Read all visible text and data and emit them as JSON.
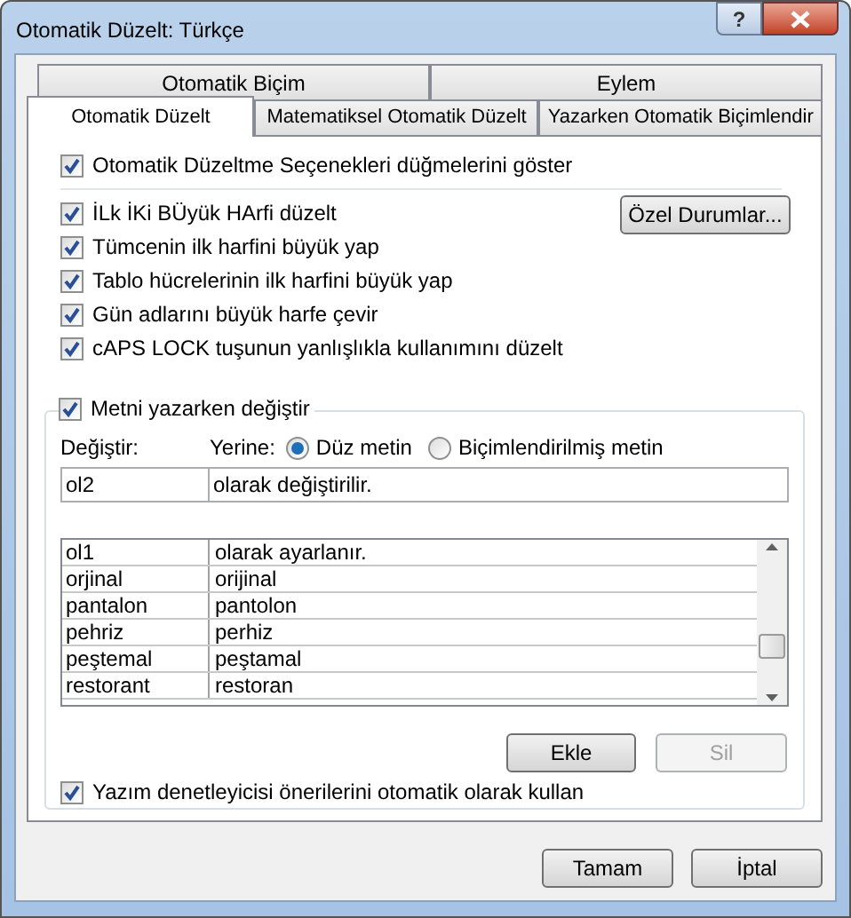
{
  "window": {
    "title": "Otomatik Düzelt: Türkçe",
    "help": "?"
  },
  "tab_rows": [
    [
      {
        "label": "Otomatik Biçim",
        "selected": false
      },
      {
        "label": "Eylem",
        "selected": false
      }
    ],
    [
      {
        "label": "Otomatik Düzelt",
        "selected": true
      },
      {
        "label": "Matematiksel Otomatik Düzelt",
        "selected": false
      },
      {
        "label": "Yazarken Otomatik Biçimlendir",
        "selected": false
      }
    ]
  ],
  "show_buttons_option": {
    "label": "Otomatik Düzeltme Seçenekleri düğmelerini göster",
    "checked": true
  },
  "options": [
    {
      "label": "İLk İKi BÜyük HArfi düzelt",
      "checked": true
    },
    {
      "label": "Tümcenin ilk harfini büyük yap",
      "checked": true
    },
    {
      "label": "Tablo hücrelerinin ilk harfini büyük yap",
      "checked": true
    },
    {
      "label": "Gün adlarını büyük harfe çevir",
      "checked": true
    },
    {
      "label": "cAPS LOCK tuşunun yanlışlıkla kullanımını düzelt",
      "checked": true
    }
  ],
  "exceptions_button": "Özel Durumlar...",
  "replace_group": {
    "label": "Metni yazarken değiştir",
    "checked": true,
    "replace_label": "Değiştir:",
    "with_label": "Yerine:",
    "format_options": [
      {
        "label": "Düz metin",
        "selected": true
      },
      {
        "label": "Biçimlendirilmiş metin",
        "selected": false
      }
    ],
    "replace_value": "ol2",
    "with_value": "olarak değiştirilir.",
    "entries": [
      {
        "replace": "ol1",
        "with": "olarak ayarlanır."
      },
      {
        "replace": "orjinal",
        "with": "orijinal"
      },
      {
        "replace": "pantalon",
        "with": "pantolon"
      },
      {
        "replace": "pehriz",
        "with": "perhiz"
      },
      {
        "replace": "peştemal",
        "with": "peştamal"
      },
      {
        "replace": "restorant",
        "with": "restoran"
      }
    ],
    "add_button": {
      "label": "Ekle",
      "disabled": false
    },
    "delete_button": {
      "label": "Sil",
      "disabled": true
    },
    "spelling_option": {
      "label": "Yazım denetleyicisi önerilerini otomatik olarak kullan",
      "checked": true
    }
  },
  "buttons": [
    {
      "label": "Tamam"
    },
    {
      "label": "İptal"
    }
  ]
}
